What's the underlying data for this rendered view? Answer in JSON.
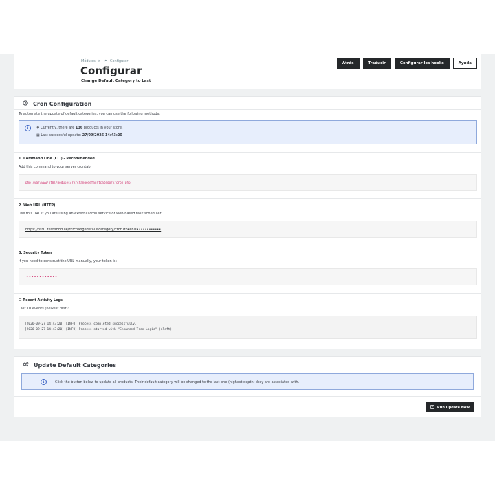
{
  "breadcrumb": {
    "modules": "Módulos",
    "separator": ">",
    "current_icon": "wrench-icon",
    "current": "Configurar"
  },
  "header": {
    "title": "Configurar",
    "subtitle": "Change Default Category to Last"
  },
  "toolbar": {
    "back": "Atrás",
    "translate": "Traducir",
    "hooks": "Configurar los hooks",
    "help": "Ayuda"
  },
  "cron": {
    "title": "Cron Configuration",
    "title_icon": "clock-icon",
    "intro": "To automate the update of default categories, you can use the following methods:",
    "alert": {
      "icon": "info-icon",
      "count_prefix": "Currently, there are ",
      "count": "136",
      "count_suffix": " products in your store.",
      "last_prefix": "Last successful update: ",
      "last_value": "27/09/2026 14:43:20"
    },
    "cli": {
      "title": "1. Command Line (CLI) - Recommended",
      "desc": "Add this command to your server crontab:",
      "command": "php /var/www/html/modules/rkrchangedefaultcategory/cron.php"
    },
    "web": {
      "title": "2. Web URL (HTTP)",
      "desc": "Use this URL if you are using an external cron service or web-based task scheduler:",
      "url": "https://ps91.test/module/rkrchangedefaultcategory/cron?token=••••••••••••"
    },
    "token": {
      "title": "3. Security Token",
      "desc": "If you need to construct the URL manually, your token is:",
      "value": "••••••••••••"
    },
    "logs": {
      "title": "Recent Activity Logs",
      "title_icon": "list-icon",
      "desc": "Last 10 events (newest first):",
      "lines": [
        "[2026-09-27 14:43:20] [INFO] Process completed successfully.",
        "[2026-09-27 14:43:20] [INFO] Process started with \"Enhanced Tree Logic\" (nleft)."
      ]
    }
  },
  "update": {
    "title": "Update Default Categories",
    "title_icon": "cogs-icon",
    "alert": "Click the button below to update all products. Their default category will be changed to the last one (highest depth) they are associated with.",
    "button": "Run Update Now",
    "button_icon": "save-icon"
  },
  "colors": {
    "dark": "#25282a",
    "info_bg": "#e7eefc",
    "info_border": "#8fa9dc",
    "code_red": "#d0316e",
    "backdrop": "#eff1f2"
  }
}
